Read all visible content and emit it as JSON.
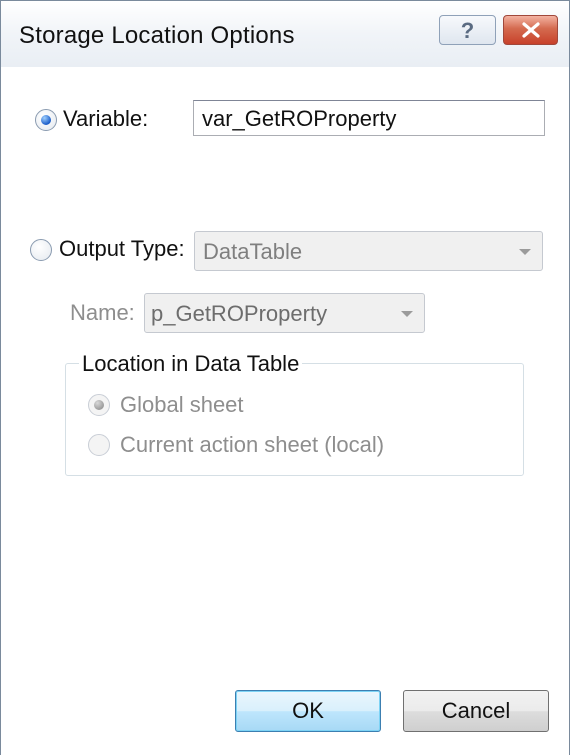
{
  "window": {
    "title": "Storage Location Options"
  },
  "titlebar": {
    "help_glyph": "?",
    "help_icon": "help-icon",
    "close_icon": "close-icon"
  },
  "variable": {
    "label": "Variable:",
    "value": "var_GetROProperty",
    "selected": true
  },
  "output_type": {
    "label": "Output Type:",
    "value": "DataTable",
    "selected": false
  },
  "name": {
    "label": "Name:",
    "value": "p_GetROProperty",
    "enabled": false
  },
  "location": {
    "title": "Location in Data Table",
    "options": [
      {
        "label": "Global sheet",
        "selected": true,
        "enabled": false
      },
      {
        "label": "Current action sheet (local)",
        "selected": false,
        "enabled": false
      }
    ]
  },
  "buttons": {
    "ok": "OK",
    "cancel": "Cancel"
  },
  "colors": {
    "accent": "#1a5cc8",
    "close_button": "#c8412a",
    "disabled_text": "#8e8e8e"
  }
}
